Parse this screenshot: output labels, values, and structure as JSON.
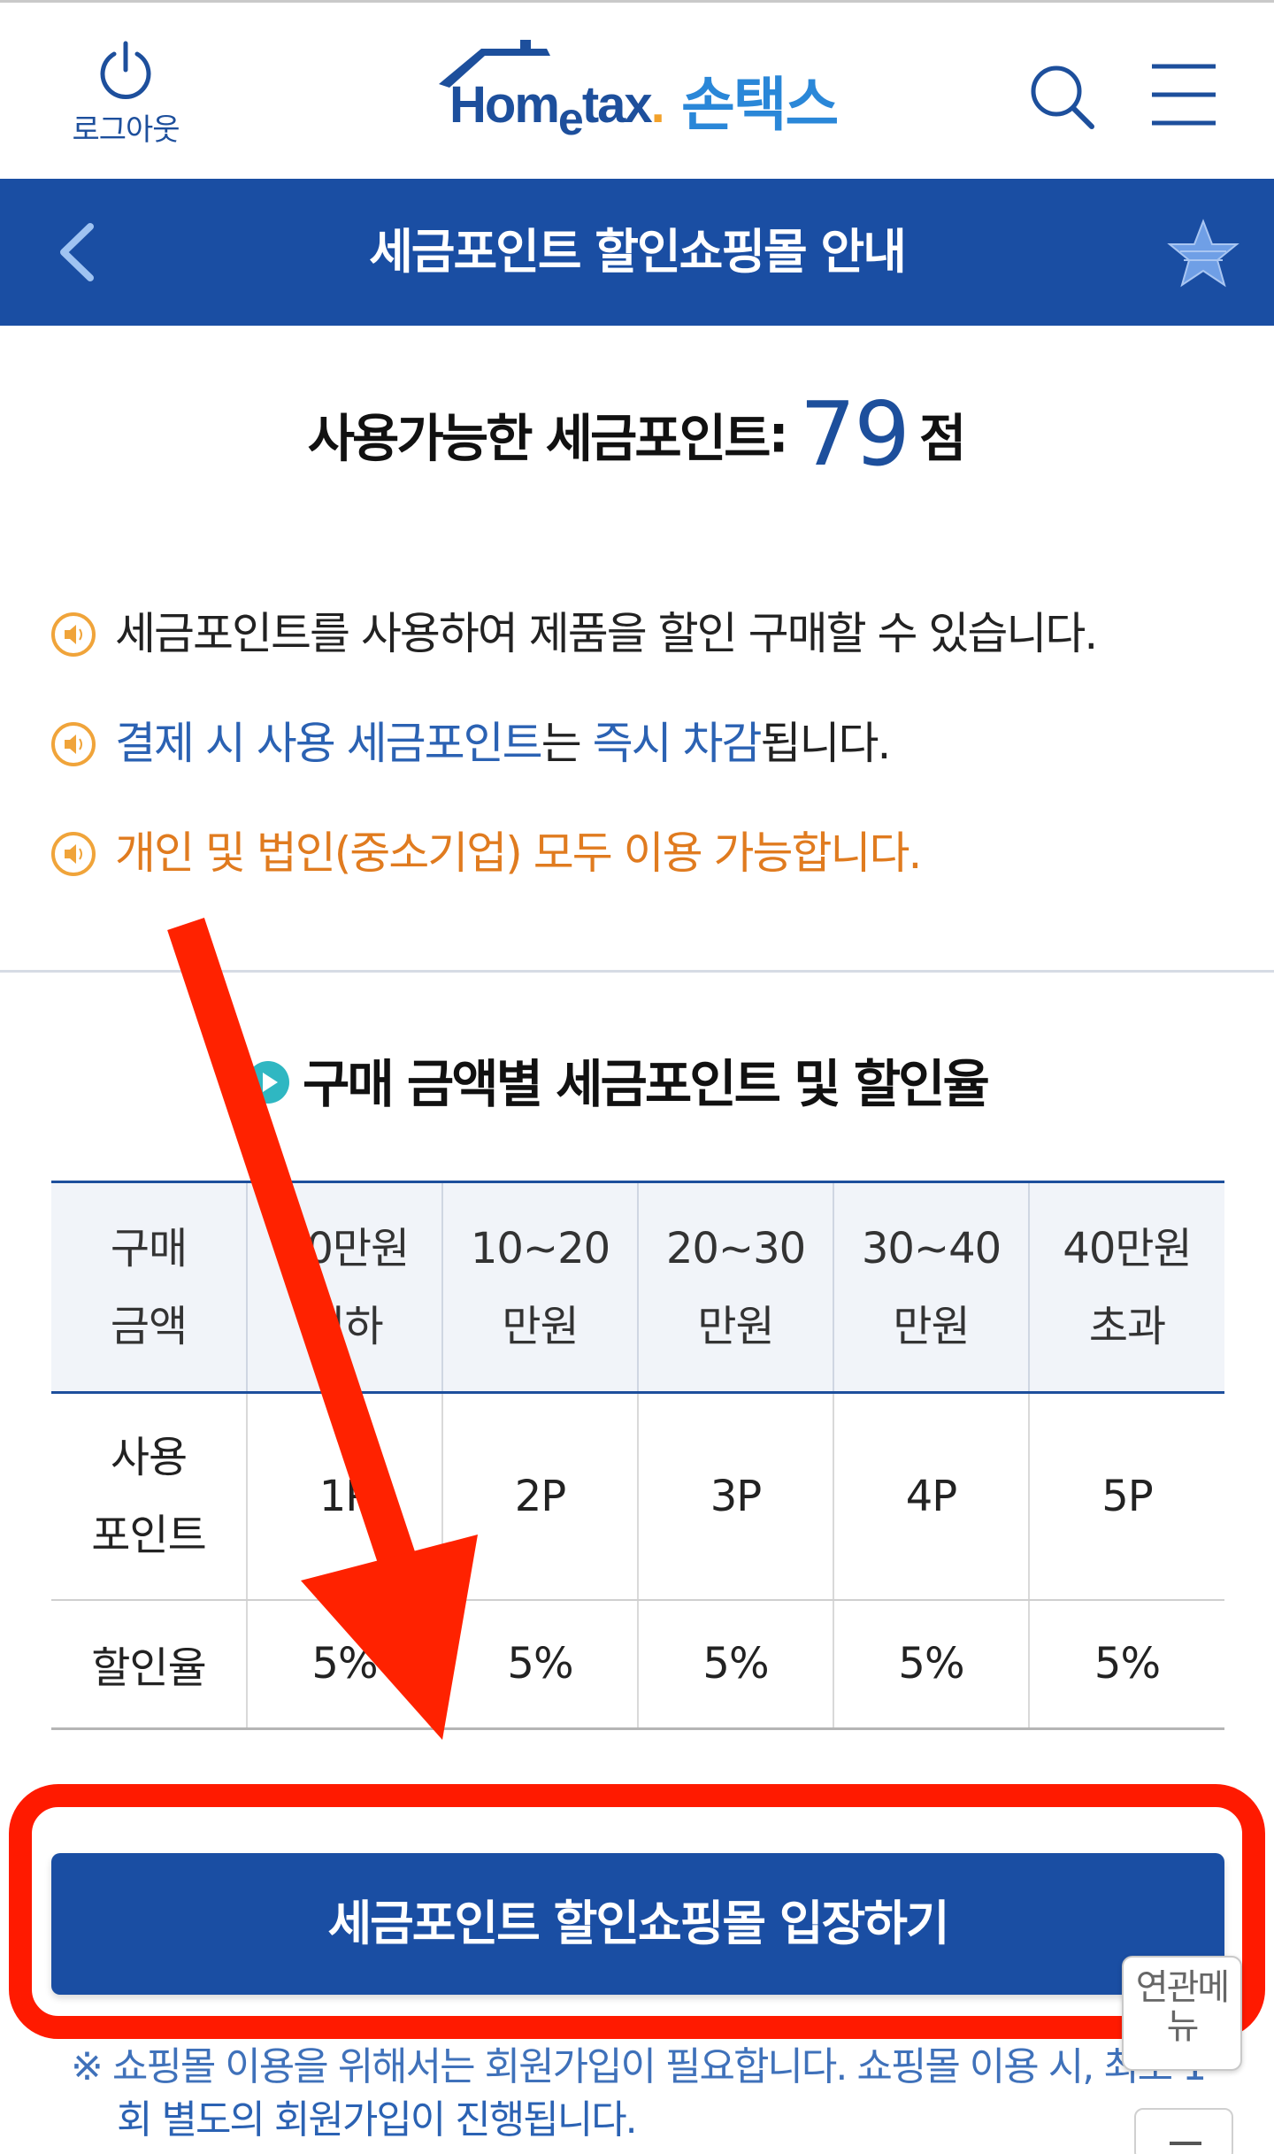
{
  "header": {
    "logout_label": "로그아웃",
    "logo_text_pre": "Hom",
    "logo_text_e": "e",
    "logo_text_post": "tax",
    "logo_dot": ".",
    "logo_korean": "손택스"
  },
  "title_bar": {
    "title": "세금포인트 할인쇼핑몰 안내"
  },
  "points": {
    "label": "사용가능한 세금포인트",
    "colon": ":",
    "value": "79",
    "unit": "점"
  },
  "notices": {
    "n1": "세금포인트를 사용하여 제품을 할인 구매할 수 있습니다.",
    "n2_a": "결제 시 사용 세금포인트",
    "n2_b": "는 ",
    "n2_c": "즉시 차감",
    "n2_d": "됩니다.",
    "n3": "개인 및 법인(중소기업) 모두 이용 가능합니다."
  },
  "section": {
    "title": "구매 금액별 세금포인트 및 할인율"
  },
  "table": {
    "header": [
      [
        "구매",
        "금액"
      ],
      [
        "10만원",
        "이하"
      ],
      [
        "10~20",
        "만원"
      ],
      [
        "20~30",
        "만원"
      ],
      [
        "30~40",
        "만원"
      ],
      [
        "40만원",
        "초과"
      ]
    ],
    "row_points": {
      "label": [
        "사용",
        "포인트"
      ],
      "values": [
        "1P",
        "2P",
        "3P",
        "4P",
        "5P"
      ]
    },
    "row_rate": {
      "label": "할인율",
      "values": [
        "5%",
        "5%",
        "5%",
        "5%",
        "5%"
      ]
    }
  },
  "enter_button": {
    "label": "세금포인트 할인쇼핑몰 입장하기"
  },
  "bottom_note": {
    "line1": "※ 쇼핑몰 이용을 위해서는 회원가입이 필요합니다. 쇼핑몰 이용 시, 최초 1",
    "line2": "회 별도의 회원가입이 진행됩니다."
  },
  "related_menu": {
    "label": "연관메뉴"
  },
  "colors": {
    "brand_blue": "#1a4ea3",
    "link_blue": "#2b62b3",
    "notice_orange": "#e07b1f",
    "annotation_red": "#ff1a00"
  }
}
